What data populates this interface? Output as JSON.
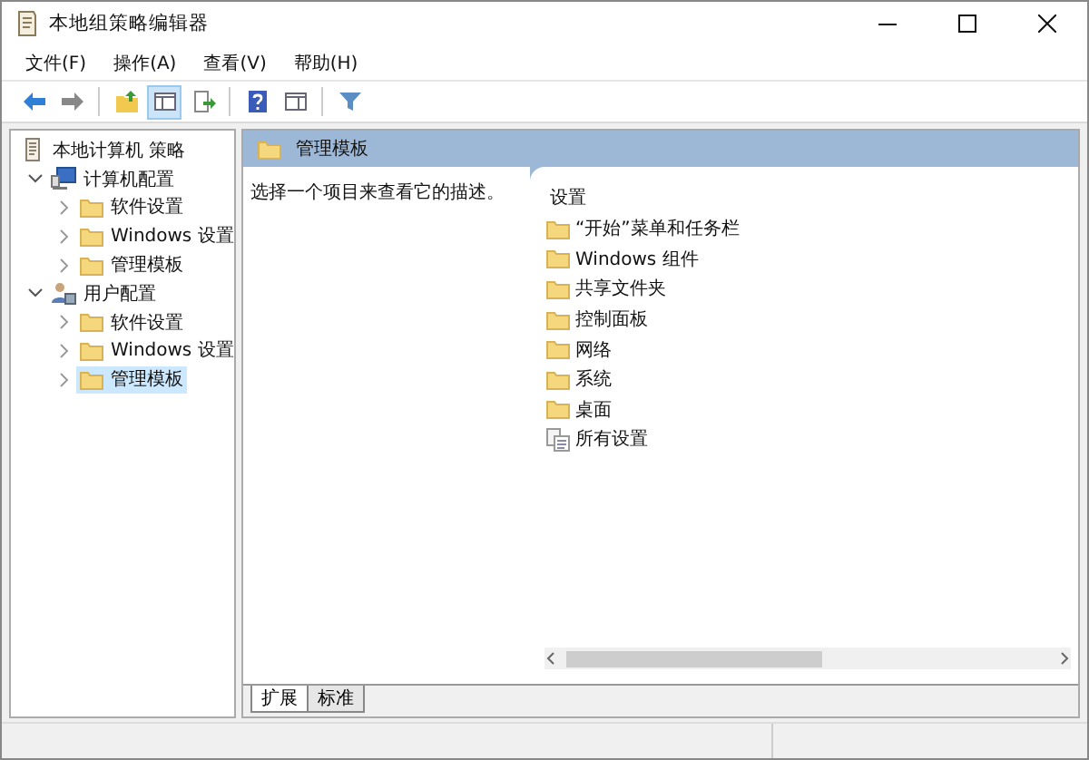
{
  "window": {
    "title": "本地组策略编辑器"
  },
  "menu": [
    "文件(F)",
    "操作(A)",
    "查看(V)",
    "帮助(H)"
  ],
  "toolbar": [
    {
      "kind": "back",
      "pressed": false
    },
    {
      "kind": "forward",
      "pressed": false
    },
    {
      "kind": "sep"
    },
    {
      "kind": "up",
      "pressed": false
    },
    {
      "kind": "tree",
      "pressed": true
    },
    {
      "kind": "export",
      "pressed": false
    },
    {
      "kind": "sep"
    },
    {
      "kind": "help",
      "pressed": false
    },
    {
      "kind": "pane",
      "pressed": false
    },
    {
      "kind": "sep"
    },
    {
      "kind": "filter",
      "pressed": false
    }
  ],
  "tree": [
    {
      "label": "本地计算机 策略",
      "kind": "policy",
      "selected": false,
      "children": [
        {
          "label": "计算机配置",
          "kind": "computer",
          "expanded": true,
          "selected": false,
          "children": [
            {
              "label": "软件设置",
              "kind": "folder",
              "expanded": false,
              "selected": false
            },
            {
              "label": "Windows 设置",
              "kind": "folder",
              "expanded": false,
              "selected": false
            },
            {
              "label": "管理模板",
              "kind": "folder",
              "expanded": false,
              "selected": false
            }
          ]
        },
        {
          "label": "用户配置",
          "kind": "user",
          "expanded": true,
          "selected": false,
          "children": [
            {
              "label": "软件设置",
              "kind": "folder",
              "expanded": false,
              "selected": false
            },
            {
              "label": "Windows 设置",
              "kind": "folder",
              "expanded": false,
              "selected": false
            },
            {
              "label": "管理模板",
              "kind": "folder",
              "expanded": false,
              "selected": true
            }
          ]
        }
      ]
    }
  ],
  "detail": {
    "header": "管理模板",
    "description": "选择一个项目来查看它的描述。",
    "list_heading": "设置",
    "items": [
      {
        "label": "“开始”菜单和任务栏",
        "kind": "folder"
      },
      {
        "label": "Windows 组件",
        "kind": "folder"
      },
      {
        "label": "共享文件夹",
        "kind": "folder"
      },
      {
        "label": "控制面板",
        "kind": "folder"
      },
      {
        "label": "网络",
        "kind": "folder"
      },
      {
        "label": "系统",
        "kind": "folder"
      },
      {
        "label": "桌面",
        "kind": "folder"
      },
      {
        "label": "所有设置",
        "kind": "settings"
      }
    ]
  },
  "tabs": [
    {
      "label": "扩展",
      "selected": true
    },
    {
      "label": "标准",
      "selected": false
    }
  ]
}
